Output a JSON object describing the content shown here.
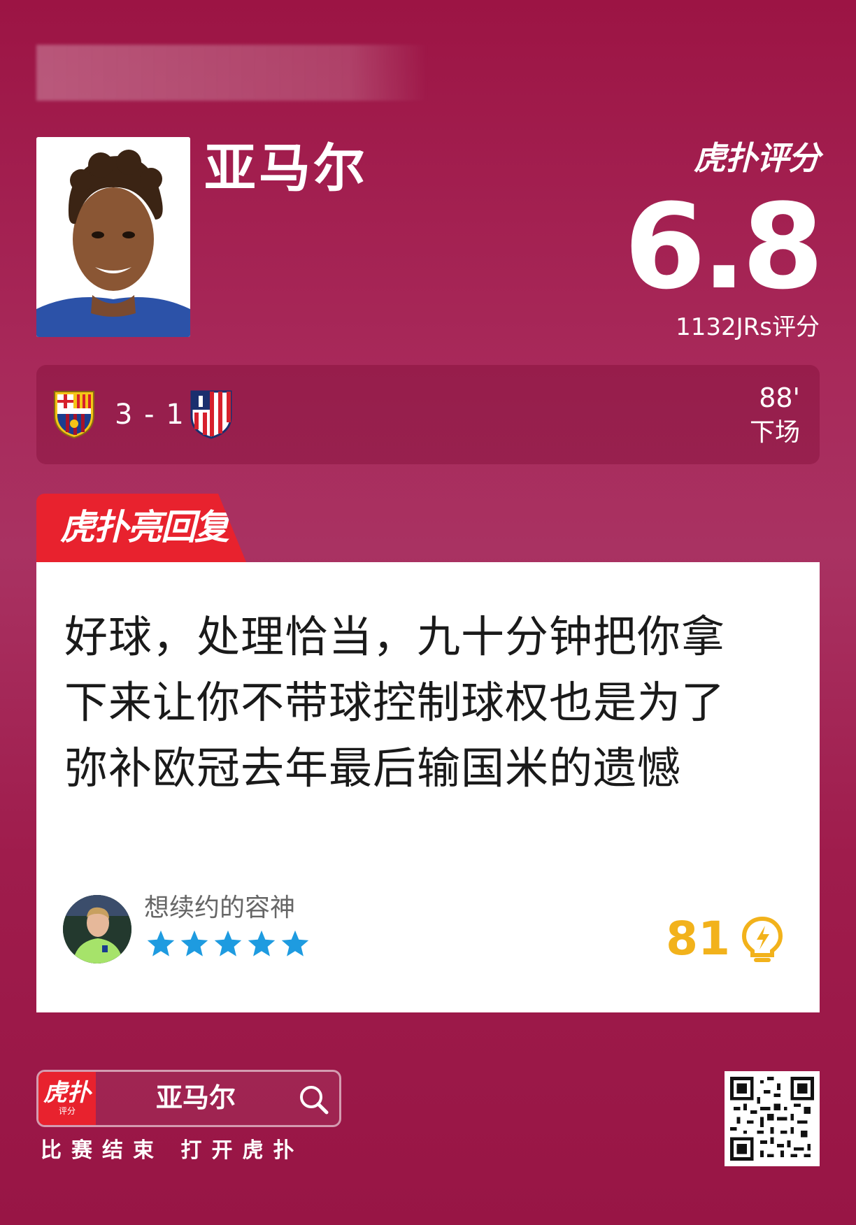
{
  "player": {
    "name": "亚马尔",
    "photo_icon": "player-portrait"
  },
  "rating": {
    "brand": "虎扑评分",
    "score": "6.8",
    "count_label": "1132JRs评分"
  },
  "match": {
    "home_crest": "fc-barcelona-crest",
    "score": "3 - 1",
    "away_crest": "atletico-madrid-crest",
    "minute": "88'",
    "status": "下场"
  },
  "reply": {
    "tab_label": "虎扑亮回复",
    "lines": [
      "好球，处理恰当，九十分钟把你拿",
      "下来让你不带球控制球权也是为了",
      "弥补欧冠去年最后输国米的遗憾"
    ],
    "user": {
      "name": "想续约的容神",
      "stars": 5,
      "star_color": "#1e9be0"
    },
    "likes": "81",
    "like_color": "#f2b21b"
  },
  "footer": {
    "app_logo_main": "虎扑",
    "app_logo_sub": "评分",
    "search_text": "亚马尔",
    "hint": "比赛结束 打开虎扑",
    "qr_icon": "qr-code"
  },
  "colors": {
    "accent_red": "#e8222e",
    "background": "#9c1444"
  }
}
